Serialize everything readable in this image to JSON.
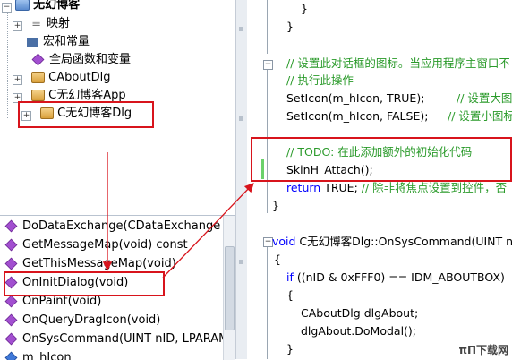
{
  "class_tree": {
    "root": "无幻博客",
    "items": [
      {
        "label": "映射"
      },
      {
        "label": "宏和常量"
      },
      {
        "label": "全局函数和变量"
      },
      {
        "label": "CAboutDlg"
      },
      {
        "label": "C无幻博客App"
      },
      {
        "label": "C无幻博客Dlg"
      }
    ]
  },
  "members": [
    {
      "label": "DoDataExchange(CDataExchange *p"
    },
    {
      "label": "GetMessageMap(void) const"
    },
    {
      "label": "GetThisMessageMap(void)"
    },
    {
      "label": "OnInitDialog(void)"
    },
    {
      "label": "OnPaint(void)"
    },
    {
      "label": "OnQueryDragIcon(void)"
    },
    {
      "label": "OnSysCommand(UINT nID, LPARAM"
    },
    {
      "label": "m_hIcon"
    }
  ],
  "code": {
    "l1": "}",
    "l2": "}",
    "l3": "// 设置此对话框的图标。当应用程序主窗口不",
    "l4": "//  执行此操作",
    "l5a": "SetIcon(m_hIcon, TRUE);",
    "l5b": "// 设置大图",
    "l6a": "SetIcon(m_hIcon, FALSE);",
    "l6b": "// 设置小图标",
    "l7": "// TODO: 在此添加额外的初始化代码",
    "l8": "SkinH_Attach();",
    "l9a": "return",
    "l9b": " TRUE;  ",
    "l9c": "// 除非将焦点设置到控件，否",
    "l10": "}",
    "l11a": "void",
    "l11b": " C无幻博客Dlg::OnSysCommand(UINT n",
    "l12": "{",
    "l13a": "if",
    "l13b": " ((nID & 0xFFF0) == IDM_ABOUTBOX)",
    "l14": "{",
    "l15": "CAboutDlg dlgAbout;",
    "l16": "dlgAbout.DoModal();",
    "l17": "}"
  },
  "watermark": "πΠ下载网"
}
